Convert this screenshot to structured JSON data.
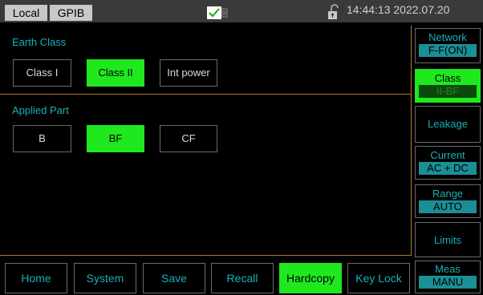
{
  "topbar": {
    "mode_local": "Local",
    "mode_gpib": "GPIB",
    "usb_icon": "usb-check-icon",
    "lock_icon": "lock-icon",
    "datetime": "14:44:13 2022.07.20"
  },
  "earth_class": {
    "title": "Earth Class",
    "options": [
      "Class I",
      "Class II",
      "Int power"
    ],
    "selected": "Class II"
  },
  "applied_part": {
    "title": "Applied Part",
    "options": [
      "B",
      "BF",
      "CF"
    ],
    "selected": "BF"
  },
  "softkeys": [
    "Home",
    "System",
    "Save",
    "Recall",
    "Hardcopy",
    "Key Lock"
  ],
  "softkey_selected": "Hardcopy",
  "right_menu": {
    "network": {
      "label": "Network",
      "value": "F-F(ON)"
    },
    "class": {
      "label": "Class",
      "value": "II-BF"
    },
    "leakage": {
      "label": "Leakage"
    },
    "current": {
      "label": "Current",
      "value": "AC + DC"
    },
    "range": {
      "label": "Range",
      "value": "AUTO"
    },
    "limits": {
      "label": "Limits"
    },
    "meas": {
      "label": "Meas",
      "value": "MANU"
    }
  },
  "colors": {
    "accent_green": "#1fe81f",
    "label_cyan": "#18b0b8",
    "divider_orange": "#b07a2a"
  }
}
